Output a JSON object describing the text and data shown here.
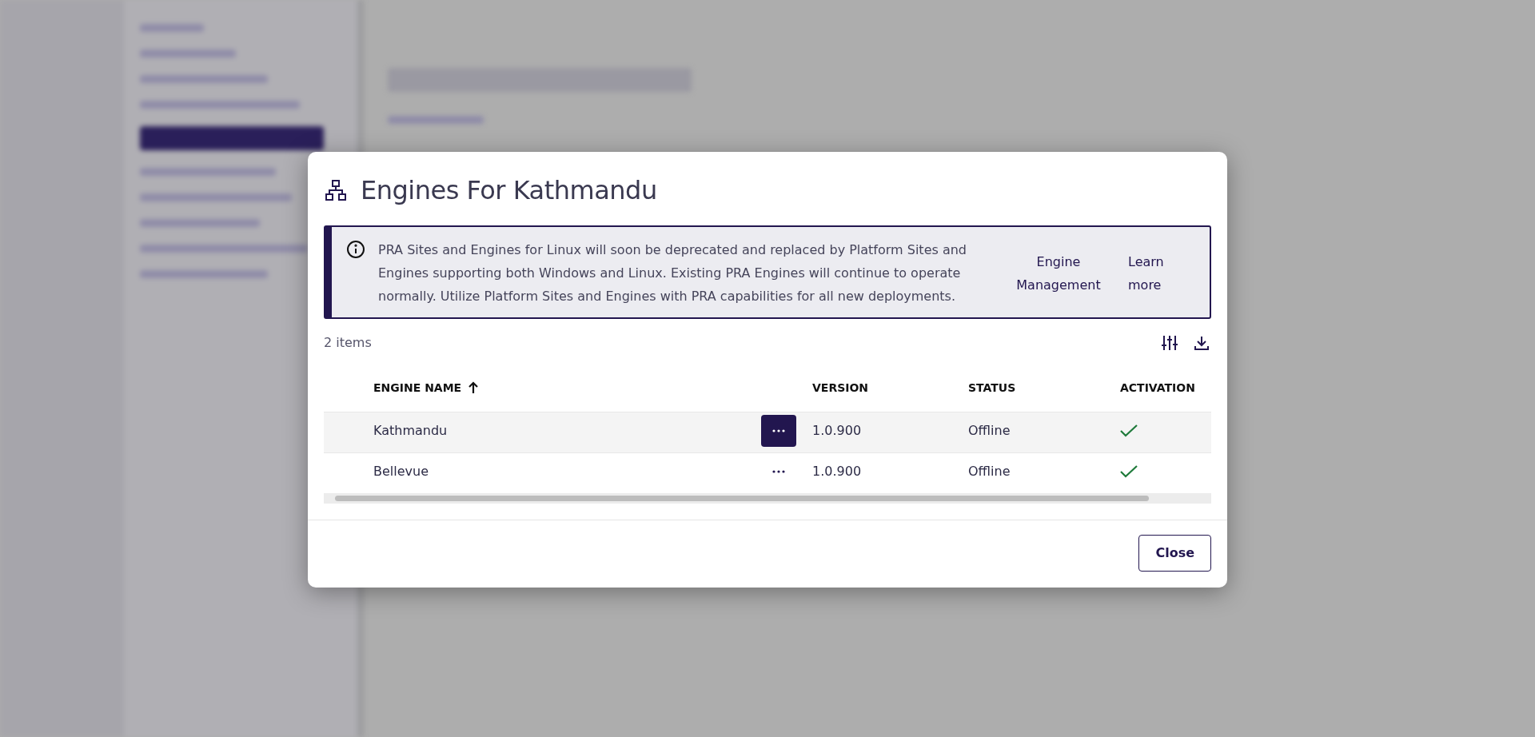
{
  "dialog": {
    "title": "Engines For Kathmandu",
    "notice": {
      "text": "PRA Sites and Engines for Linux will soon be deprecated and replaced by Platform Sites and Engines supporting both Windows and Linux. Existing PRA Engines will continue to operate normally. Utilize Platform Sites and Engines with PRA capabilities for all new deployments.",
      "links": [
        "Engine Management",
        "Learn more"
      ]
    },
    "item_count": "2 items",
    "table": {
      "columns": [
        {
          "label": "ENGINE NAME",
          "sorted": true
        },
        {
          "label": "VERSION",
          "sorted": false
        },
        {
          "label": "STATUS",
          "sorted": false
        },
        {
          "label": "ACTIVATION",
          "sorted": false
        }
      ],
      "rows": [
        {
          "engine_name": "Kathmandu",
          "version": "1.0.900",
          "status": "Offline",
          "activated": true,
          "hovered": true
        },
        {
          "engine_name": "Bellevue",
          "version": "1.0.900",
          "status": "Offline",
          "activated": true,
          "hovered": false
        }
      ]
    },
    "buttons": [
      "Close"
    ]
  }
}
